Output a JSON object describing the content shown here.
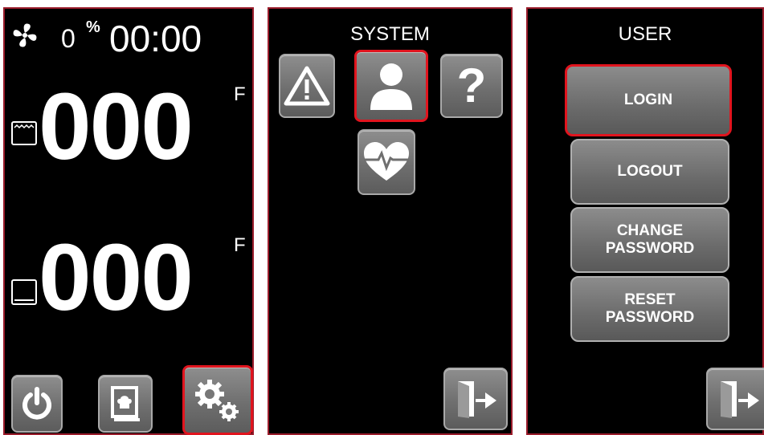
{
  "left_panel": {
    "humidity_value": "0",
    "humidity_unit": "%",
    "timer": "00:00",
    "oven_temp": "000",
    "oven_unit": "F",
    "probe_temp": "000",
    "probe_unit": "F"
  },
  "system_panel": {
    "title": "SYSTEM"
  },
  "user_panel": {
    "title": "USER",
    "login_label": "LOGIN",
    "logout_label": "LOGOUT",
    "change_password_label": "CHANGE\nPASSWORD",
    "reset_password_label": "RESET\nPASSWORD"
  },
  "colors": {
    "panel_border": "#9a1c2b",
    "selection": "#e1141e",
    "button_gray": "#7a7a7a"
  }
}
